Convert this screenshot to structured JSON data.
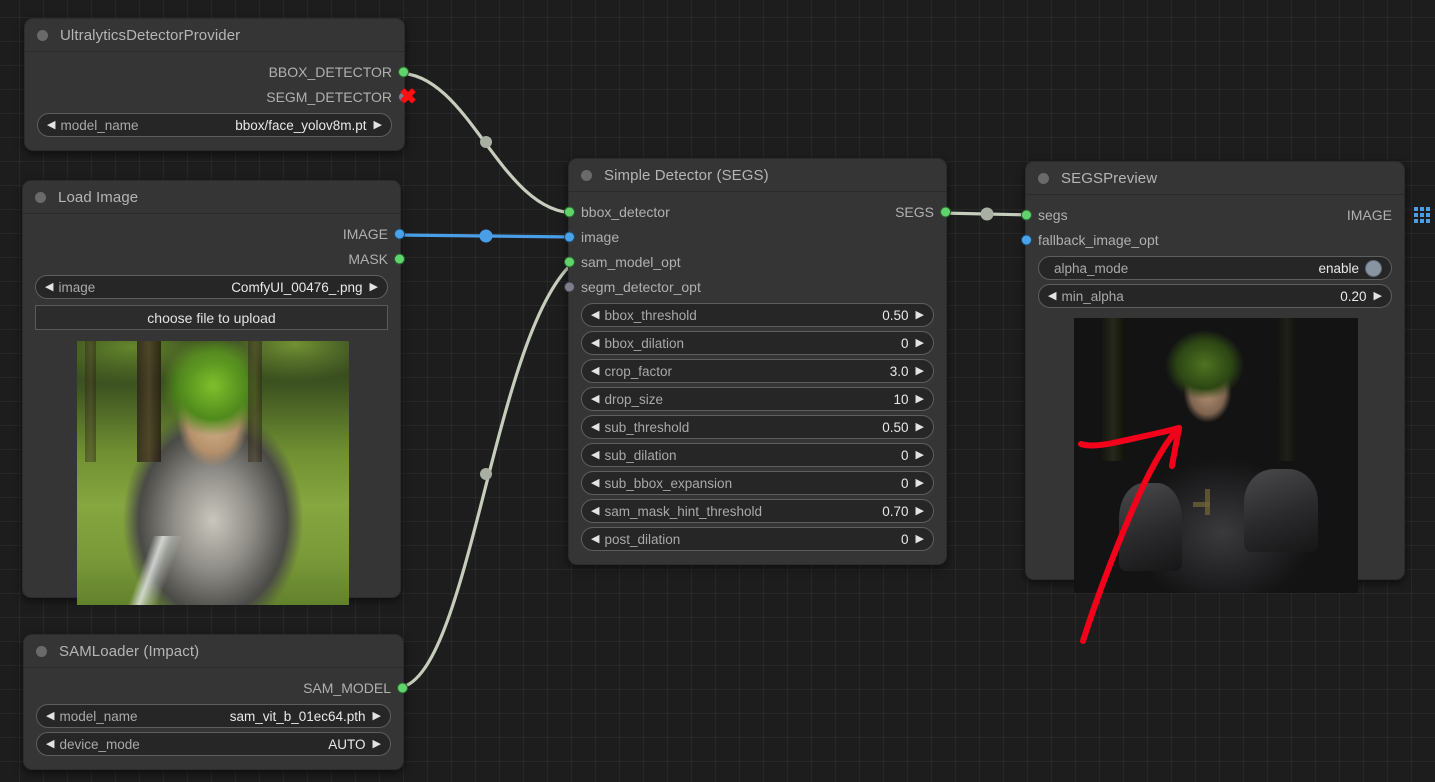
{
  "app": {
    "background": "#1d1d1d",
    "grid_size": 24
  },
  "colors": {
    "link_model": "#c6cdbd",
    "link_image": "#4a9ee8",
    "socket_green": "#60d46a",
    "socket_blue": "#4aa3e8",
    "socket_grey": "#7d7d8c",
    "annotation_red": "#f5001a",
    "node_body": "#353535"
  },
  "nodes": {
    "ultralytics": {
      "title": "UltralyticsDetectorProvider",
      "collapse_icon": "collapse-dot-icon",
      "outputs": [
        {
          "label": "BBOX_DETECTOR",
          "color": "green",
          "connected": true
        },
        {
          "label": "SEGM_DETECTOR",
          "color": "grey",
          "connected": false,
          "badge": "✖"
        }
      ],
      "widgets": [
        {
          "name": "model_name",
          "value": "bbox/face_yolov8m.pt",
          "type": "combo",
          "left_arrow": "◀",
          "right_arrow": "▶"
        }
      ]
    },
    "load_image": {
      "title": "Load Image",
      "collapse_icon": "collapse-dot-icon",
      "outputs": [
        {
          "label": "IMAGE",
          "color": "blue",
          "connected": true
        },
        {
          "label": "MASK",
          "color": "green",
          "connected": false
        }
      ],
      "widgets": [
        {
          "name": "image",
          "value": "ComfyUI_00476_.png",
          "type": "combo",
          "left_arrow": "◀",
          "right_arrow": "▶"
        }
      ],
      "upload_button": "choose file to upload",
      "preview_alt": "anime knight with green hair in forest"
    },
    "simple_detector": {
      "title": "Simple Detector (SEGS)",
      "collapse_icon": "collapse-dot-icon",
      "inputs": [
        {
          "label": "bbox_detector",
          "color": "green",
          "connected": true
        },
        {
          "label": "image",
          "color": "blue",
          "connected": true
        },
        {
          "label": "sam_model_opt",
          "color": "green",
          "connected": true
        },
        {
          "label": "segm_detector_opt",
          "color": "grey",
          "connected": false
        }
      ],
      "outputs": [
        {
          "label": "SEGS",
          "color": "green",
          "connected": true
        }
      ],
      "widgets": [
        {
          "name": "bbox_threshold",
          "value": "0.50",
          "left_arrow": "◀",
          "right_arrow": "▶"
        },
        {
          "name": "bbox_dilation",
          "value": "0",
          "left_arrow": "◀",
          "right_arrow": "▶"
        },
        {
          "name": "crop_factor",
          "value": "3.0",
          "left_arrow": "◀",
          "right_arrow": "▶"
        },
        {
          "name": "drop_size",
          "value": "10",
          "left_arrow": "◀",
          "right_arrow": "▶"
        },
        {
          "name": "sub_threshold",
          "value": "0.50",
          "left_arrow": "◀",
          "right_arrow": "▶"
        },
        {
          "name": "sub_dilation",
          "value": "0",
          "left_arrow": "◀",
          "right_arrow": "▶"
        },
        {
          "name": "sub_bbox_expansion",
          "value": "0",
          "left_arrow": "◀",
          "right_arrow": "▶"
        },
        {
          "name": "sam_mask_hint_threshold",
          "value": "0.70",
          "left_arrow": "◀",
          "right_arrow": "▶"
        },
        {
          "name": "post_dilation",
          "value": "0",
          "left_arrow": "◀",
          "right_arrow": "▶"
        }
      ]
    },
    "segs_preview": {
      "title": "SEGSPreview",
      "collapse_icon": "collapse-dot-icon",
      "inputs": [
        {
          "label": "segs",
          "color": "green",
          "connected": true
        },
        {
          "label": "fallback_image_opt",
          "color": "blue",
          "connected": false
        }
      ],
      "outputs": [
        {
          "label": "IMAGE",
          "icon": "grid-icon"
        }
      ],
      "widgets": [
        {
          "name": "alpha_mode",
          "value": "enable",
          "type": "toggle"
        },
        {
          "name": "min_alpha",
          "value": "0.20",
          "type": "number",
          "left_arrow": "◀",
          "right_arrow": "▶"
        }
      ],
      "preview_alt": "darkened close-up of knight face detection result"
    },
    "sam_loader": {
      "title": "SAMLoader (Impact)",
      "collapse_icon": "collapse-dot-icon",
      "outputs": [
        {
          "label": "SAM_MODEL",
          "color": "green",
          "connected": true
        }
      ],
      "widgets": [
        {
          "name": "model_name",
          "value": "sam_vit_b_01ec64.pth",
          "left_arrow": "◀",
          "right_arrow": "▶"
        },
        {
          "name": "device_mode",
          "value": "AUTO",
          "left_arrow": "◀",
          "right_arrow": "▶"
        }
      ]
    }
  },
  "annotation": {
    "type": "hand-drawn-arrow",
    "color": "#f5001a",
    "points_to": "detected face region in SEGSPreview"
  }
}
